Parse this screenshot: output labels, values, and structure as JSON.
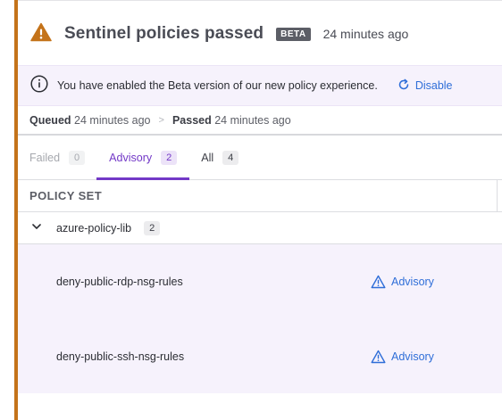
{
  "header": {
    "title": "Sentinel policies passed",
    "badge": "BETA",
    "time": "24 minutes ago",
    "icon": "warning-triangle-icon",
    "icon_color": "#c4731a"
  },
  "notice": {
    "text": "You have enabled the Beta version of our new policy experience.",
    "action_label": "Disable",
    "action_icon": "refresh-icon"
  },
  "status": {
    "queued_label": "Queued",
    "queued_time": "24 minutes ago",
    "separator": ">",
    "passed_label": "Passed",
    "passed_time": "24 minutes ago"
  },
  "tabs": [
    {
      "label": "Failed",
      "count": "0",
      "state": "disabled"
    },
    {
      "label": "Advisory",
      "count": "2",
      "state": "active"
    },
    {
      "label": "All",
      "count": "4",
      "state": "normal"
    }
  ],
  "table": {
    "column_header": "POLICY SET",
    "group": {
      "name": "azure-policy-lib",
      "count": "2",
      "icon": "chevron-down-icon"
    },
    "rows": [
      {
        "name": "deny-public-rdp-nsg-rules",
        "status": "Advisory"
      },
      {
        "name": "deny-public-ssh-nsg-rules",
        "status": "Advisory"
      }
    ]
  },
  "colors": {
    "accent_bar": "#c4731a",
    "purple": "#7339c7",
    "link_blue": "#2f6ed8",
    "row_highlight": "#f6f2fc"
  }
}
